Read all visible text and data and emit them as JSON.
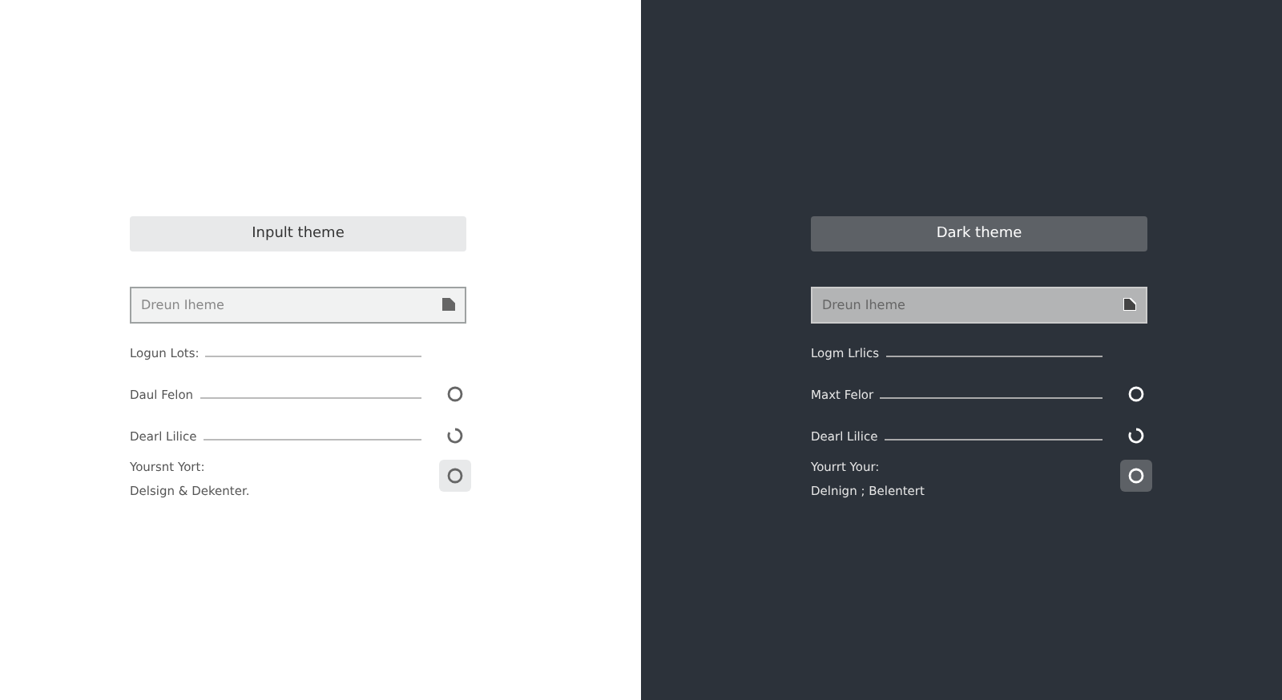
{
  "panels": [
    {
      "kind": "light",
      "header": "Inpult theme",
      "field": {
        "placeholder": "Dreun Iheme"
      },
      "rows": [
        {
          "label": "Logun Lots:"
        },
        {
          "label": "Daul Felon",
          "kind": "circle"
        },
        {
          "label": "Dearl Lilice",
          "kind": "refresh"
        }
      ],
      "footer": {
        "lines": [
          "Yoursnt Yort:",
          "Delsign & Dekenter."
        ]
      }
    },
    {
      "kind": "dark",
      "header": "Dark theme",
      "field": {
        "placeholder": "Dreun Iheme"
      },
      "rows": [
        {
          "label": "Logm Lrlics"
        },
        {
          "label": "Maxt Felor",
          "kind": "circle"
        },
        {
          "label": "Dearl Lilice",
          "kind": "refresh"
        }
      ],
      "footer": {
        "lines": [
          "Yourrt Your:",
          "Delnign ; Belentert"
        ]
      }
    }
  ]
}
